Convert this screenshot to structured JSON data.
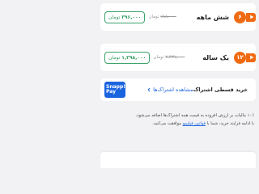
{
  "plans": [
    {
      "badge": "۶",
      "name": "شش ماهه",
      "old_price": "۷۸۸,۰۰۰",
      "old_currency": "تومان",
      "price": "۳۹۶,۰۰۰",
      "currency": "تومان"
    },
    {
      "badge": "۱۲",
      "name": "یک ساله",
      "old_price": "۲,۴۳۷,۰۰۰",
      "old_currency": "تومان",
      "price": "۱,۳۹۸,۰۰۰",
      "currency": "تومان"
    }
  ],
  "snapp_pay": {
    "logo_line1": "Snapp!",
    "logo_line2": "Pay",
    "title": "خرید قسطی اشتراک",
    "link_label": "مشاهده اشتراک‌ها"
  },
  "notes": {
    "line1": "۱۰٪ مالیات بر ارزش افزوده به قیمت همه اشتراک‌ها اضافه می‌شود.",
    "line2_before": "با ادامه فرایند خرید، شما با ",
    "line2_link": "قوانین فیلیمو",
    "line2_after": " موافقت می‌کنید."
  },
  "colors": {
    "accent_orange": "#f06a12",
    "price_green": "#2f9c60",
    "link_blue": "#1b64e0",
    "background": "#f2f2f4"
  },
  "icons": {
    "play": "play-icon",
    "chevron": "chevron-left-icon"
  }
}
